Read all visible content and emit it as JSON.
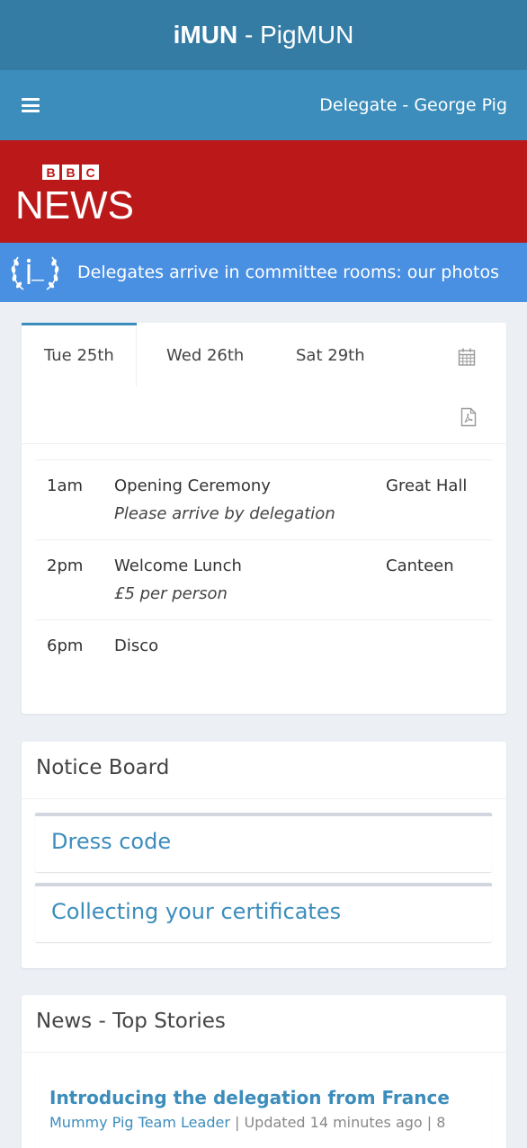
{
  "app": {
    "title_bold": "iMUN",
    "title_rest": " - PigMUN"
  },
  "navbar": {
    "user_label": "Delegate - George Pig"
  },
  "banner": {
    "brand_letters": [
      "B",
      "B",
      "C"
    ],
    "brand_word": "NEWS"
  },
  "ticker": {
    "headline": "Delegates arrive in committee rooms: our photos"
  },
  "schedule": {
    "tabs": [
      {
        "label": "Tue 25th"
      },
      {
        "label": "Wed 26th"
      },
      {
        "label": "Sat 29th"
      }
    ],
    "events": [
      {
        "time": "1am",
        "name": "Opening Ceremony",
        "note": "Please arrive by delegation",
        "place": "Great Hall"
      },
      {
        "time": "2pm",
        "name": "Welcome Lunch",
        "note": "£5 per person",
        "place": "Canteen"
      },
      {
        "time": "6pm",
        "name": "Disco",
        "note": "",
        "place": ""
      }
    ]
  },
  "notice_board": {
    "title": "Notice Board",
    "items": [
      {
        "label": "Dress code"
      },
      {
        "label": "Collecting your certificates"
      }
    ]
  },
  "news": {
    "title": "News - Top Stories",
    "items": [
      {
        "headline": "Introducing the delegation from France",
        "author": "Mummy Pig Team Leader",
        "updated": "| Updated 14 minutes ago | 8"
      }
    ]
  },
  "colors": {
    "header_dark": "#357ca5",
    "header": "#3c8dbc",
    "bbc_red": "#bb1919",
    "ticker_blue": "#4a90e2",
    "link": "#3c8dbc"
  },
  "icons": {
    "menu": "hamburger-icon",
    "calendar": "calendar-icon",
    "pdf": "pdf-icon",
    "ticker_logo": "imun-laurel-logo"
  }
}
